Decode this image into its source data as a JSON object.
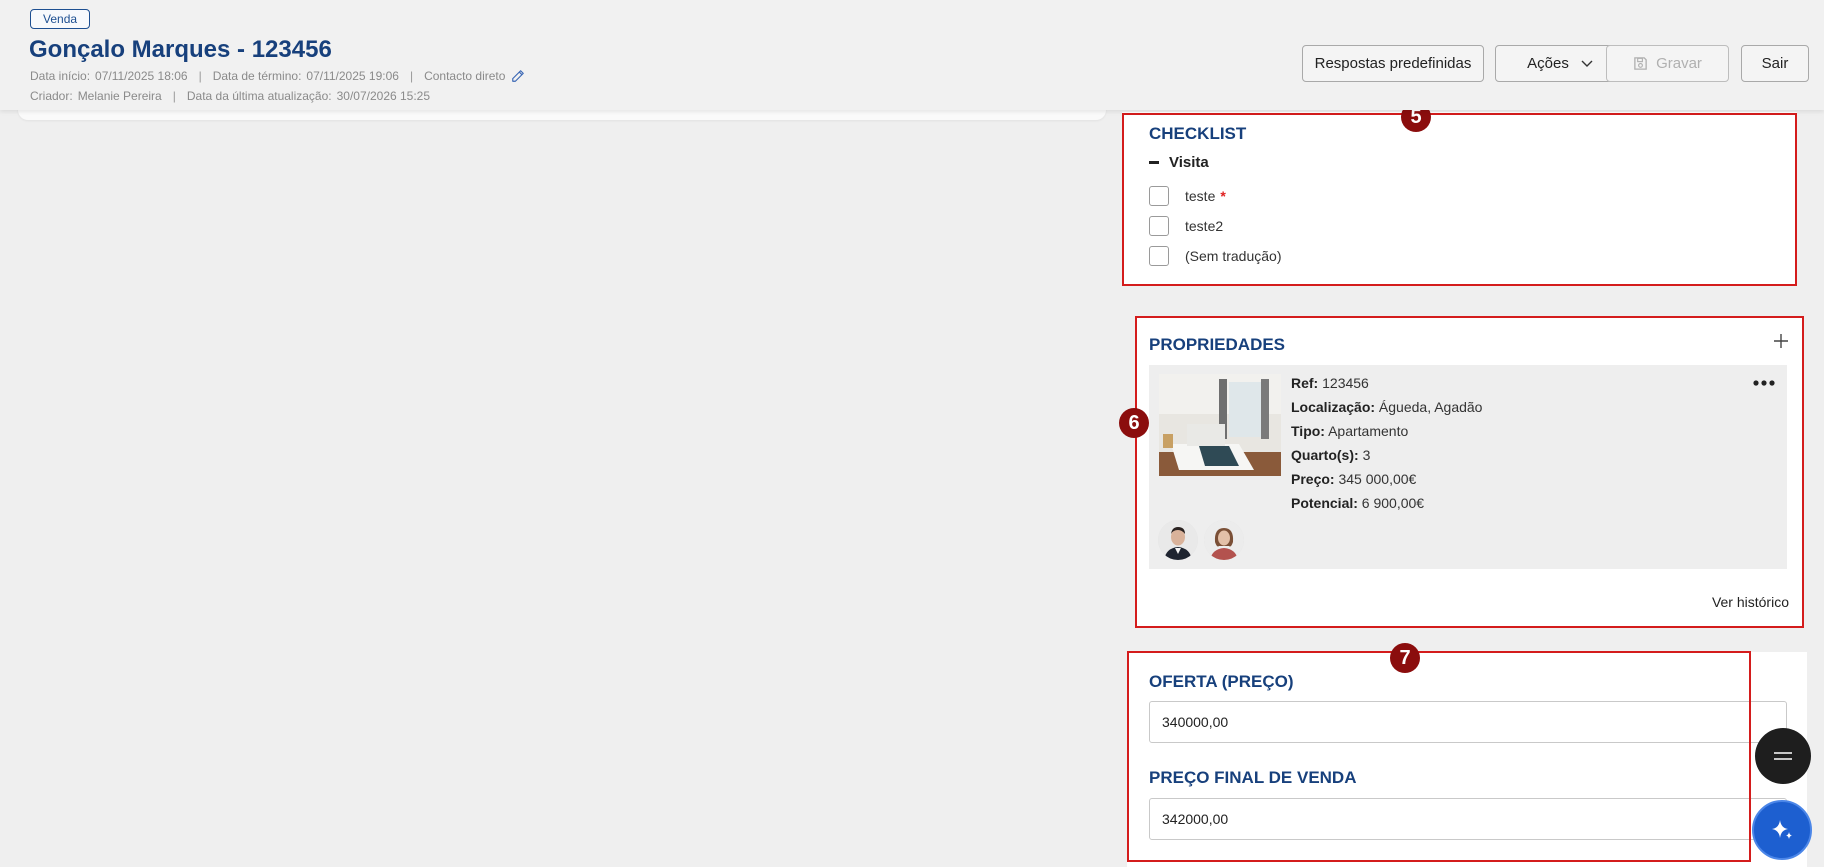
{
  "header": {
    "badge": "Venda",
    "title": "Gonçalo Marques - 123456",
    "meta": {
      "data_inicio_label": "Data início:",
      "data_inicio": "07/11/2025 18:06",
      "data_termino_label": "Data de término:",
      "data_termino": "07/11/2025 19:06",
      "contacto": "Contacto direto",
      "criador_label": "Criador:",
      "criador": "Melanie Pereira",
      "atualizacao_label": "Data da última atualização:",
      "atualizacao": "30/07/2026 15:25"
    },
    "buttons": {
      "respostas": "Respostas predefinidas",
      "acoes": "Ações",
      "gravar": "Gravar",
      "sair": "Sair"
    }
  },
  "checklist": {
    "title": "CHECKLIST",
    "group": "Visita",
    "items": [
      {
        "label": "teste",
        "required": "*"
      },
      {
        "label": "teste2"
      },
      {
        "label": "(Sem tradução)"
      }
    ]
  },
  "propriedades": {
    "title": "PROPRIEDADES",
    "ref_label": "Ref:",
    "ref": "123456",
    "localizacao_label": "Localização:",
    "localizacao": "Águeda, Agadão",
    "tipo_label": "Tipo:",
    "tipo": "Apartamento",
    "quartos_label": "Quarto(s):",
    "quartos": "3",
    "preco_label": "Preço:",
    "preco": "345 000,00€",
    "potencial_label": "Potencial:",
    "potencial": "6 900,00€",
    "ver_historico": "Ver histórico"
  },
  "oferta": {
    "oferta_title": "OFERTA (PREÇO)",
    "oferta_value": "340000,00",
    "preco_final_title": "PREÇO FINAL DE VENDA",
    "preco_final_value": "342000,00"
  },
  "annotations": [
    "5",
    "6",
    "7"
  ],
  "colors": {
    "brand": "#17407c",
    "annotation_red": "#d41c1c",
    "annotation_badge": "#8b0d0d",
    "fab_ai": "#1d5fd0"
  },
  "icons": [
    "pencil-icon",
    "chevron-down-icon",
    "save-icon",
    "minus-icon",
    "plus-icon",
    "more-icon",
    "menu-icon",
    "sparkle-icon"
  ]
}
